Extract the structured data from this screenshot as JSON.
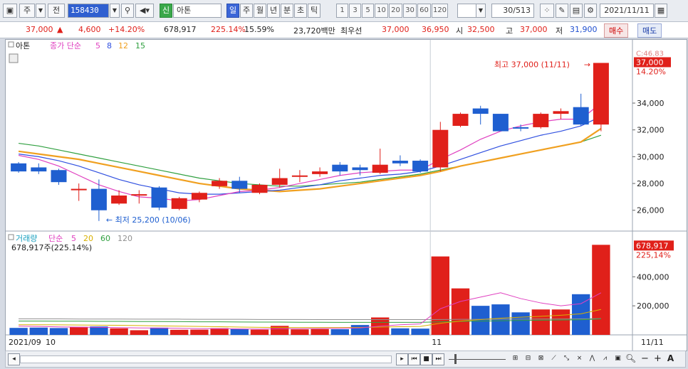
{
  "toolbar": {
    "chart_icon": "chart-icon",
    "freq_label": "주",
    "jeon_label": "전",
    "code": "158430",
    "stock_badge": "신",
    "stock_name": "아톤",
    "periods": [
      "일",
      "주",
      "월",
      "년",
      "분",
      "초",
      "틱"
    ],
    "active_period": "일",
    "counts": [
      "1",
      "3",
      "5",
      "10",
      "20",
      "30",
      "60",
      "120"
    ],
    "page_count": "30/513",
    "date": "2021/11/11"
  },
  "quote": {
    "price": "37,000",
    "arrow": "▲",
    "change": "4,600",
    "change_pct": "+14.20%",
    "volume": "678,917",
    "vol_ratio": "225.14%",
    "turnover": "15.59%",
    "amount": "23,720백만",
    "best_label": "최우선",
    "best_ask": "37,000",
    "best_bid": "36,950",
    "open_label": "시",
    "open": "32,500",
    "high_label": "고",
    "high": "37,000",
    "low_label": "저",
    "low": "31,900",
    "buy_label": "매수",
    "sell_label": "매도"
  },
  "colors": {
    "up": "#e0201a",
    "down": "#1f5fd0",
    "ma5": "#e040c0",
    "ma8": "#3050e0",
    "ma12": "#f0a020",
    "ma15": "#30a040"
  },
  "chart_data": {
    "type": "candlestick",
    "price_legend": {
      "name": "아톤",
      "ma_label": "종가 단순",
      "periods": [
        "5",
        "8",
        "12",
        "15"
      ]
    },
    "y_ticks": [
      26000,
      28000,
      30000,
      32000,
      34000
    ],
    "y_tick_labels": [
      "26,000",
      "28,000",
      "30,000",
      "32,000",
      "34,000"
    ],
    "ylim": [
      24500,
      38300
    ],
    "last_price_label": "37,000",
    "last_pct_label": "14.20%",
    "corner_label": "C:46.83",
    "high_note": "최고 37,000 (11/11)",
    "low_note": "최저 25,200 (10/06)",
    "candles": [
      {
        "o": 29500,
        "h": 29600,
        "l": 28800,
        "c": 28900
      },
      {
        "o": 29200,
        "h": 29500,
        "l": 28700,
        "c": 28900
      },
      {
        "o": 29000,
        "h": 29100,
        "l": 27900,
        "c": 28100
      },
      {
        "o": 27500,
        "h": 28000,
        "l": 26700,
        "c": 27600
      },
      {
        "o": 27600,
        "h": 28300,
        "l": 25200,
        "c": 26000
      },
      {
        "o": 26500,
        "h": 27500,
        "l": 26400,
        "c": 27100
      },
      {
        "o": 27100,
        "h": 27500,
        "l": 26500,
        "c": 27200
      },
      {
        "o": 27700,
        "h": 27800,
        "l": 26000,
        "c": 26200
      },
      {
        "o": 26100,
        "h": 27000,
        "l": 26000,
        "c": 26900
      },
      {
        "o": 26800,
        "h": 27400,
        "l": 26600,
        "c": 27300
      },
      {
        "o": 27800,
        "h": 28400,
        "l": 27600,
        "c": 28200
      },
      {
        "o": 28200,
        "h": 28500,
        "l": 27300,
        "c": 27600
      },
      {
        "o": 27300,
        "h": 28000,
        "l": 27200,
        "c": 27900
      },
      {
        "o": 27900,
        "h": 29100,
        "l": 27700,
        "c": 28400
      },
      {
        "o": 28500,
        "h": 29000,
        "l": 28100,
        "c": 28600
      },
      {
        "o": 28700,
        "h": 29200,
        "l": 28500,
        "c": 28900
      },
      {
        "o": 29400,
        "h": 29600,
        "l": 28600,
        "c": 28900
      },
      {
        "o": 29200,
        "h": 29400,
        "l": 28600,
        "c": 29000
      },
      {
        "o": 28800,
        "h": 30600,
        "l": 28700,
        "c": 29400
      },
      {
        "o": 29700,
        "h": 30100,
        "l": 29300,
        "c": 29500
      },
      {
        "o": 29700,
        "h": 29800,
        "l": 28800,
        "c": 28900
      },
      {
        "o": 29200,
        "h": 32600,
        "l": 28900,
        "c": 32000
      },
      {
        "o": 32300,
        "h": 33300,
        "l": 32200,
        "c": 33200
      },
      {
        "o": 33600,
        "h": 33800,
        "l": 32400,
        "c": 33200
      },
      {
        "o": 33200,
        "h": 33200,
        "l": 31900,
        "c": 31900
      },
      {
        "o": 32200,
        "h": 32400,
        "l": 31900,
        "c": 32100
      },
      {
        "o": 32200,
        "h": 33300,
        "l": 32100,
        "c": 33200
      },
      {
        "o": 33200,
        "h": 33600,
        "l": 32800,
        "c": 33400
      },
      {
        "o": 33700,
        "h": 34700,
        "l": 32300,
        "c": 32400
      },
      {
        "o": 32400,
        "h": 37000,
        "l": 31900,
        "c": 37000
      }
    ],
    "ma": {
      "ma5": [
        30100,
        29800,
        29300,
        28600,
        27900,
        27400,
        27000,
        26900,
        26700,
        26800,
        27100,
        27400,
        27500,
        27700,
        28000,
        28300,
        28600,
        28800,
        28900,
        29000,
        29000,
        29800,
        30500,
        31300,
        31900,
        32300,
        32600,
        32800,
        32800,
        34000
      ],
      "ma8": [
        30200,
        30000,
        29700,
        29300,
        28800,
        28300,
        27900,
        27600,
        27300,
        27200,
        27200,
        27300,
        27400,
        27500,
        27700,
        27900,
        28200,
        28400,
        28600,
        28700,
        28900,
        29300,
        29800,
        30300,
        30800,
        31200,
        31600,
        31900,
        32300,
        33000
      ],
      "ma12": [
        30400,
        30200,
        30000,
        29800,
        29500,
        29200,
        28900,
        28600,
        28300,
        28000,
        27800,
        27600,
        27500,
        27400,
        27500,
        27600,
        27800,
        28000,
        28200,
        28400,
        28600,
        28900,
        29300,
        29600,
        29900,
        30200,
        30500,
        30800,
        31100,
        32100
      ],
      "ma15": [
        31000,
        30800,
        30500,
        30200,
        29900,
        29600,
        29300,
        29000,
        28700,
        28400,
        28200,
        28000,
        27900,
        27800,
        27800,
        27900,
        28000,
        28100,
        28300,
        28500,
        28700,
        29000,
        29300,
        29600,
        29900,
        30200,
        30500,
        30800,
        31100,
        31600
      ]
    },
    "volume_legend": {
      "name": "거래량",
      "ma_label": "단순",
      "periods": [
        "5",
        "20",
        "60",
        "120"
      ]
    },
    "volume_info": "678,917주(225.14%)",
    "volume_last_label": "678,917",
    "volume_pct_label": "225,14%",
    "vol_y_ticks": [
      200000,
      400000
    ],
    "vol_y_tick_labels": [
      "200,000",
      "400,000"
    ],
    "vol_ylim": [
      0,
      700000
    ],
    "volumes": [
      48000,
      50000,
      47000,
      55000,
      58000,
      45000,
      32000,
      50000,
      35000,
      36000,
      46000,
      40000,
      36000,
      62000,
      38000,
      40000,
      39000,
      68000,
      120000,
      45000,
      43000,
      540000,
      320000,
      200000,
      210000,
      155000,
      175000,
      175000,
      280000,
      620000
    ],
    "vol_ma": {
      "ma5": [
        60000,
        58000,
        55000,
        53000,
        52000,
        50000,
        48000,
        47000,
        45000,
        43000,
        42000,
        41000,
        40000,
        42000,
        43000,
        44000,
        45000,
        48000,
        60000,
        70000,
        75000,
        180000,
        230000,
        260000,
        290000,
        250000,
        220000,
        200000,
        215000,
        290000
      ],
      "ma20": [
        70000,
        70000,
        69000,
        68000,
        67000,
        66000,
        64000,
        62000,
        60000,
        58000,
        56000,
        54000,
        52000,
        51000,
        50000,
        50000,
        50000,
        51000,
        54000,
        56000,
        58000,
        80000,
        95000,
        105000,
        115000,
        122000,
        128000,
        135000,
        145000,
        175000
      ],
      "ma60": [
        95000,
        95000,
        94000,
        94000,
        93000,
        93000,
        92000,
        92000,
        91000,
        90000,
        90000,
        89000,
        88000,
        88000,
        87000,
        87000,
        86000,
        86000,
        86000,
        86000,
        86000,
        90000,
        93000,
        95000,
        97000,
        99000,
        101000,
        102000,
        104000,
        110000
      ],
      "ma120": [
        110000,
        110000,
        110000,
        109000,
        109000,
        109000,
        108000,
        108000,
        108000,
        107000,
        107000,
        107000,
        106000,
        106000,
        106000,
        105000,
        105000,
        105000,
        105000,
        105000,
        105000,
        106000,
        107000,
        107000,
        108000,
        108000,
        109000,
        109000,
        110000,
        112000
      ]
    },
    "x_labels": [
      "2021/09",
      "10",
      "11"
    ],
    "x_right_label": "11/11"
  }
}
